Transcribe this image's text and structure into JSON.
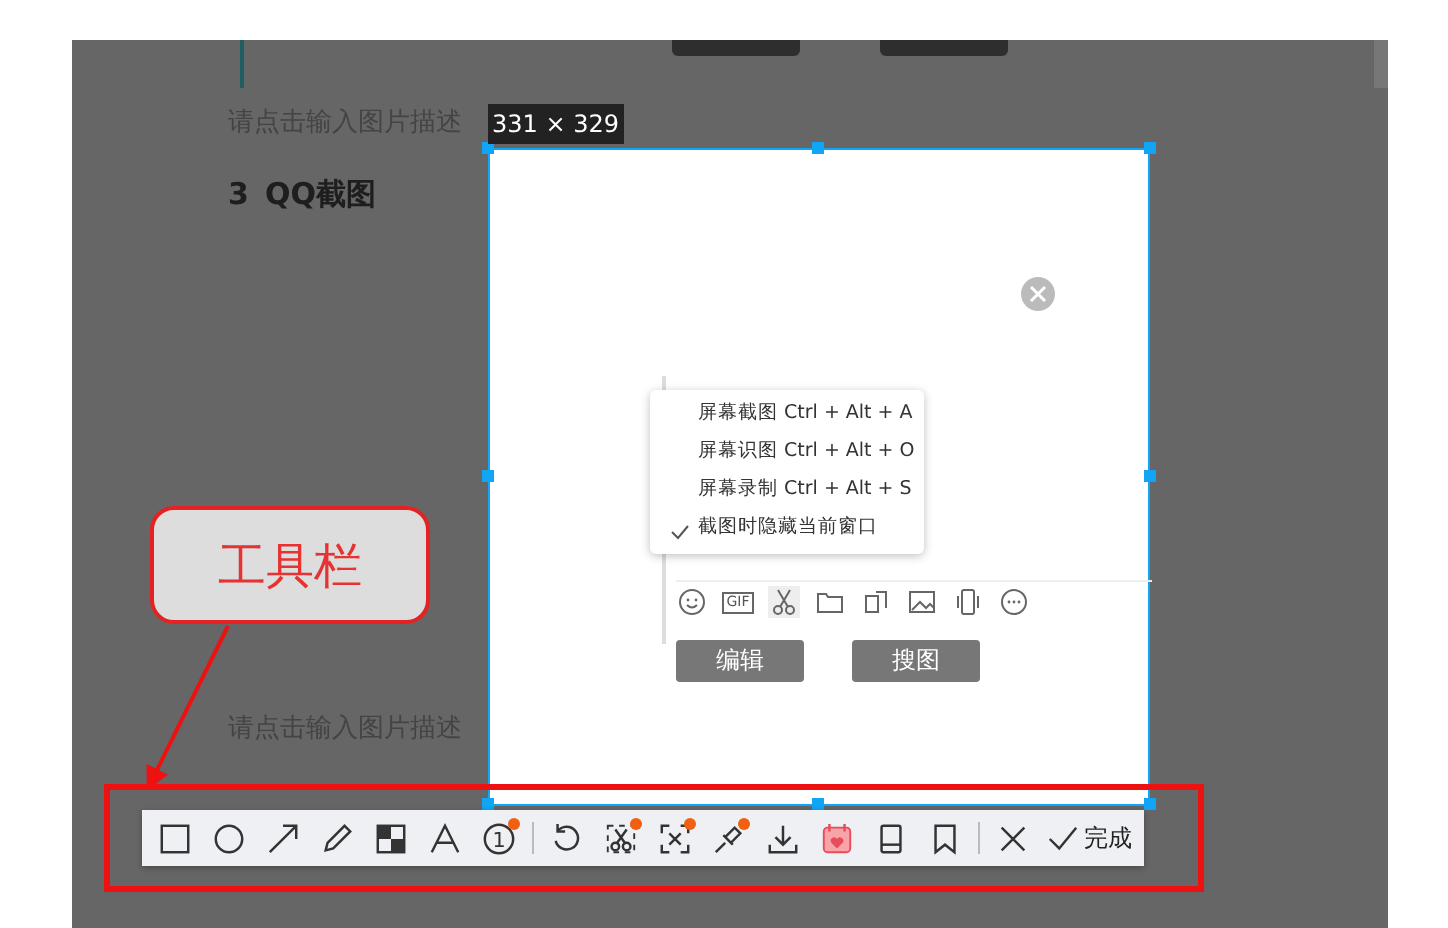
{
  "article": {
    "captions": [
      "请点击输入图片描述",
      "请点击输入图片描述"
    ],
    "heading_number": "3",
    "heading": "QQ截图"
  },
  "selection": {
    "size_label": "331 × 329"
  },
  "menu": {
    "items": [
      {
        "label": "屏幕截图 Ctrl + Alt + A",
        "checked": false
      },
      {
        "label": "屏幕识图 Ctrl + Alt + O",
        "checked": false
      },
      {
        "label": "屏幕录制 Ctrl + Alt + S",
        "checked": false
      },
      {
        "label": "截图时隐藏当前窗口",
        "checked": true
      }
    ]
  },
  "chat_tools": [
    {
      "kind": "emoji"
    },
    {
      "kind": "gif",
      "label": "GIF"
    },
    {
      "kind": "scissors",
      "selected": true
    },
    {
      "kind": "folder",
      "selected": false
    },
    {
      "kind": "shapes",
      "selected": false
    },
    {
      "kind": "image",
      "selected": false
    },
    {
      "kind": "shake",
      "selected": false
    },
    {
      "kind": "more",
      "selected": false
    }
  ],
  "chat_buttons": [
    "编辑",
    "搜图"
  ],
  "callout": {
    "label": "工具栏"
  },
  "toolbar": [
    {
      "kind": "rect",
      "dot": false
    },
    {
      "kind": "circle",
      "dot": false
    },
    {
      "kind": "arrow",
      "dot": false
    },
    {
      "kind": "pencil",
      "dot": false
    },
    {
      "kind": "mosaic",
      "dot": false
    },
    {
      "kind": "text",
      "dot": false
    },
    {
      "kind": "number",
      "label": "1",
      "dot": true
    },
    {
      "kind": "separator"
    },
    {
      "kind": "undo",
      "dot": false
    },
    {
      "kind": "cut",
      "dot": true
    },
    {
      "kind": "ocr",
      "dot": true
    },
    {
      "kind": "pin",
      "dot": true
    },
    {
      "kind": "download",
      "dot": false
    },
    {
      "kind": "calendar",
      "dot": false
    },
    {
      "kind": "phone",
      "dot": false
    },
    {
      "kind": "bookmark",
      "dot": false
    },
    {
      "kind": "separator"
    },
    {
      "kind": "close",
      "dot": false
    },
    {
      "kind": "done",
      "label": "完成"
    }
  ]
}
